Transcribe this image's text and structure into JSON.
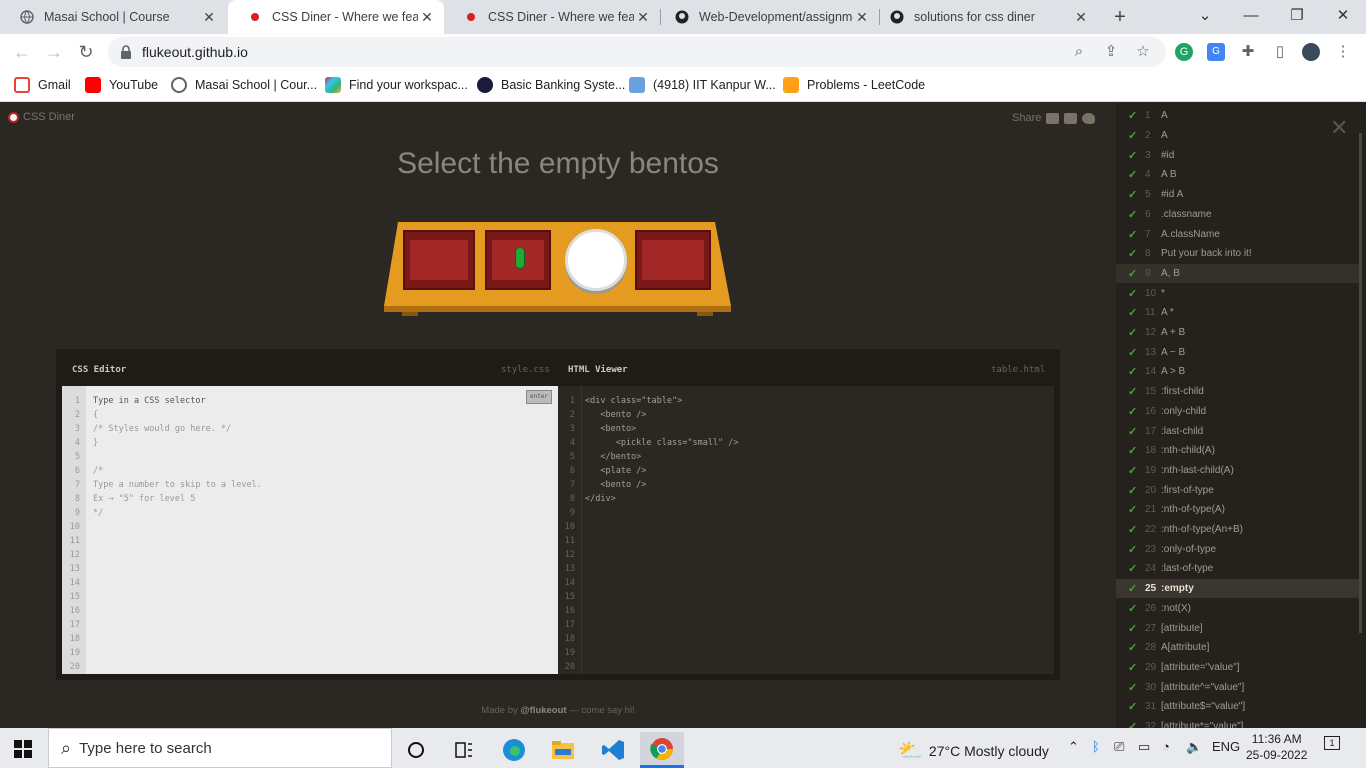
{
  "browser": {
    "tabs": [
      {
        "title": "Masai School | Course",
        "active": false
      },
      {
        "title": "CSS Diner - Where we feast on CSS Selectors!",
        "active": true
      },
      {
        "title": "CSS Diner - Where we feast on CSS Selectors!",
        "active": false
      },
      {
        "title": "Web-Development/assignments",
        "active": false
      },
      {
        "title": "solutions for css diner",
        "active": false
      }
    ],
    "url": "flukeout.github.io",
    "bookmarks": [
      "Gmail",
      "YouTube",
      "Masai School | Cour...",
      "Find your workspac...",
      "Basic Banking Syste...",
      "(4918) IIT Kanpur W...",
      "Problems - LeetCode"
    ]
  },
  "page": {
    "logo": "CSS Diner",
    "share": "Share",
    "instruction": "Select the empty bentos",
    "css_editor": {
      "title": "CSS Editor",
      "file": "style.css",
      "enter": "enter",
      "lines": [
        "Type in a CSS selector",
        "{",
        "/* Styles would go here. */",
        "}",
        "",
        "/*",
        "Type a number to skip to a level.",
        "Ex → \"5\" for level 5",
        "*/"
      ]
    },
    "html_viewer": {
      "title": "HTML Viewer",
      "file": "table.html",
      "lines": [
        "<div class=\"table\">",
        "   <bento />",
        "   <bento>",
        "      <pickle class=\"small\" />",
        "   </bento>",
        "   <plate />",
        "   <bento />",
        "</div>"
      ]
    },
    "footer_prefix": "Made by ",
    "footer_author": "@flukeout",
    "footer_suffix": " — come say hi!",
    "line_numbers": [
      "1",
      "2",
      "3",
      "4",
      "5",
      "6",
      "7",
      "8",
      "9",
      "10",
      "11",
      "12",
      "13",
      "14",
      "15",
      "16",
      "17",
      "18",
      "19",
      "20"
    ]
  },
  "levels": [
    {
      "n": "1",
      "name": "A"
    },
    {
      "n": "2",
      "name": "A"
    },
    {
      "n": "3",
      "name": "#id"
    },
    {
      "n": "4",
      "name": "A  B"
    },
    {
      "n": "5",
      "name": "#id  A"
    },
    {
      "n": "6",
      "name": ".classname"
    },
    {
      "n": "7",
      "name": "A.className"
    },
    {
      "n": "8",
      "name": "Put your back into it!"
    },
    {
      "n": "9",
      "name": "A, B"
    },
    {
      "n": "10",
      "name": "*"
    },
    {
      "n": "11",
      "name": "A  *"
    },
    {
      "n": "12",
      "name": "A + B"
    },
    {
      "n": "13",
      "name": "A ~ B"
    },
    {
      "n": "14",
      "name": "A > B"
    },
    {
      "n": "15",
      "name": ":first-child"
    },
    {
      "n": "16",
      "name": ":only-child"
    },
    {
      "n": "17",
      "name": ":last-child"
    },
    {
      "n": "18",
      "name": ":nth-child(A)"
    },
    {
      "n": "19",
      "name": ":nth-last-child(A)"
    },
    {
      "n": "20",
      "name": ":first-of-type"
    },
    {
      "n": "21",
      "name": ":nth-of-type(A)"
    },
    {
      "n": "22",
      "name": ":nth-of-type(An+B)"
    },
    {
      "n": "23",
      "name": ":only-of-type"
    },
    {
      "n": "24",
      "name": ":last-of-type"
    },
    {
      "n": "25",
      "name": ":empty"
    },
    {
      "n": "26",
      "name": ":not(X)"
    },
    {
      "n": "27",
      "name": "[attribute]"
    },
    {
      "n": "28",
      "name": "A[attribute]"
    },
    {
      "n": "29",
      "name": "[attribute=\"value\"]"
    },
    {
      "n": "30",
      "name": "[attribute^=\"value\"]"
    },
    {
      "n": "31",
      "name": "[attribute$=\"value\"]"
    },
    {
      "n": "32",
      "name": "[attribute*=\"value\"]"
    }
  ],
  "taskbar": {
    "search_placeholder": "Type here to search",
    "weather": "27°C  Mostly cloudy",
    "lang": "ENG",
    "time": "11:36 AM",
    "date": "25-09-2022",
    "notif_count": "1"
  }
}
